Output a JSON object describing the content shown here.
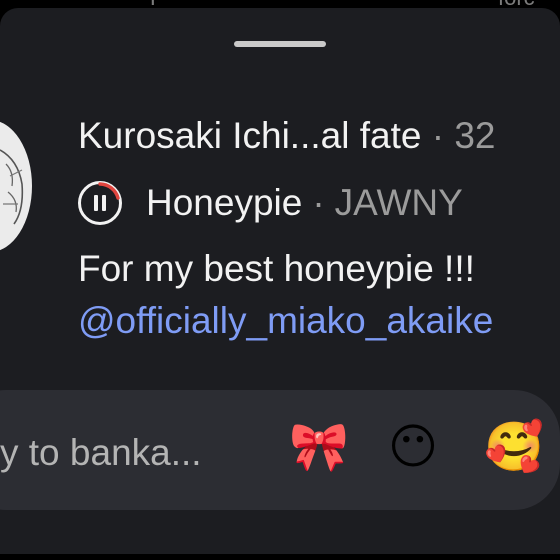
{
  "top_strip": {
    "left_text": "F",
    "right_text": "forc"
  },
  "story_reply": {
    "username": "Kurosaki Ichi...al fate",
    "separator": "·",
    "time": "32",
    "music": {
      "state_icon": "pause-icon",
      "title": "Honeypie",
      "separator": "·",
      "artist": "JAWNY"
    },
    "caption": "For my best honeypie !!!",
    "mention": "@officially_miako_akaike",
    "reply_input": {
      "placeholder": "y to banka..."
    },
    "quick_reactions": [
      {
        "name": "ribbon",
        "glyph": "🎀"
      },
      {
        "name": "neutral-face",
        "glyph": "😶"
      },
      {
        "name": "smiling-face-with-hearts",
        "glyph": "🥰"
      }
    ]
  },
  "colors": {
    "sheet_background": "#1c1d21",
    "reply_bar_background": "#2c2d33",
    "primary_text": "#f2f2f2",
    "secondary_text": "#9b9b9b",
    "mention_link": "#7f9cf5",
    "progress_arc": "#e0453f"
  }
}
